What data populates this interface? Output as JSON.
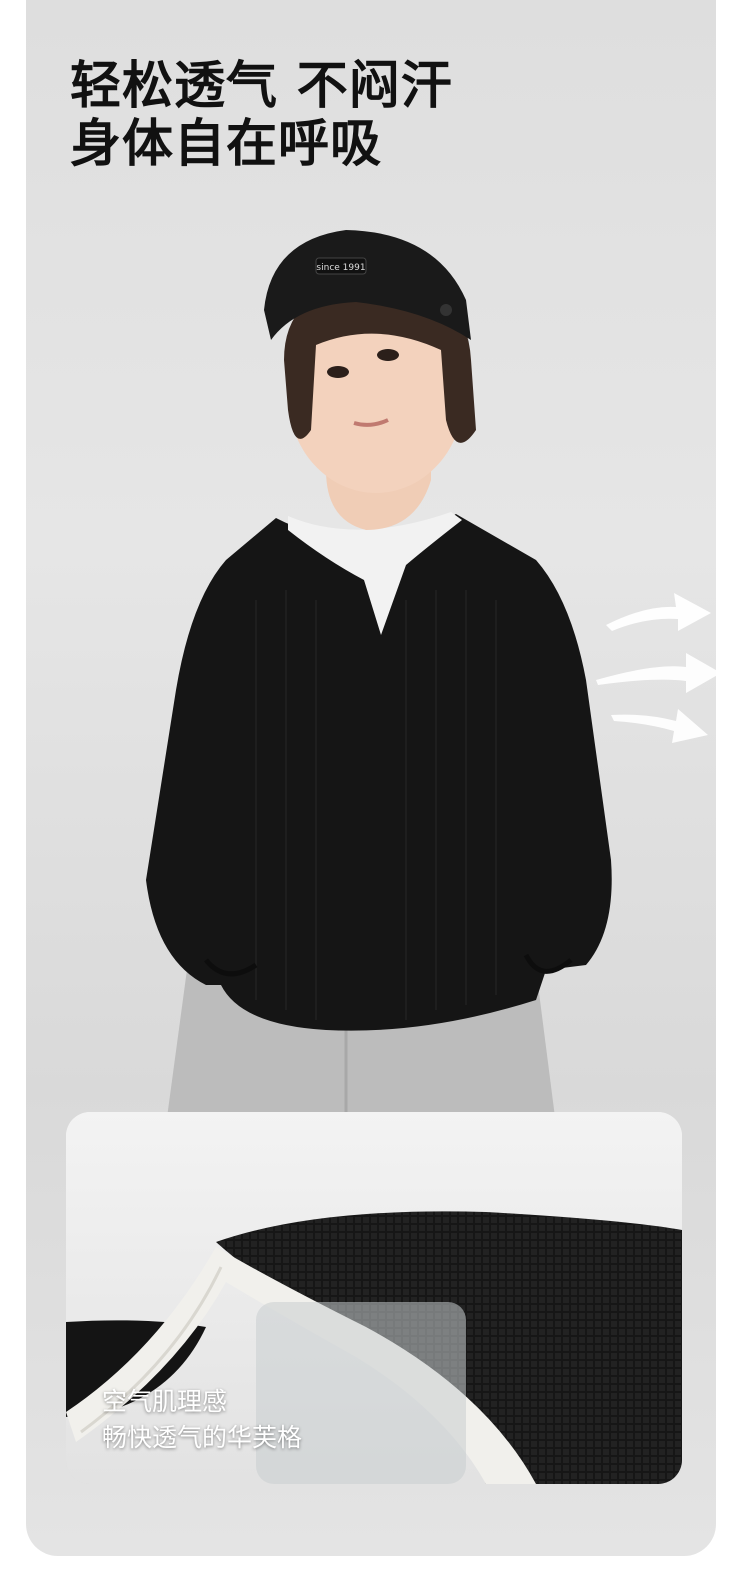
{
  "headline": {
    "line1": "轻松透气 不闷汗",
    "line2": "身体自在呼吸"
  },
  "cap": {
    "brand_text": "since 1991"
  },
  "detail_card": {
    "caption_line1": "空气肌理感",
    "caption_line2": "畅快透气的华芙格"
  },
  "icons": [
    "airflow-arrow-icon"
  ],
  "colors": {
    "background": "#e2e2e2",
    "sweater": "#141414",
    "trim": "#f2f2f2",
    "pants": "#bdbdbd",
    "headline_text": "#111111",
    "caption_text": "#ffffff"
  }
}
